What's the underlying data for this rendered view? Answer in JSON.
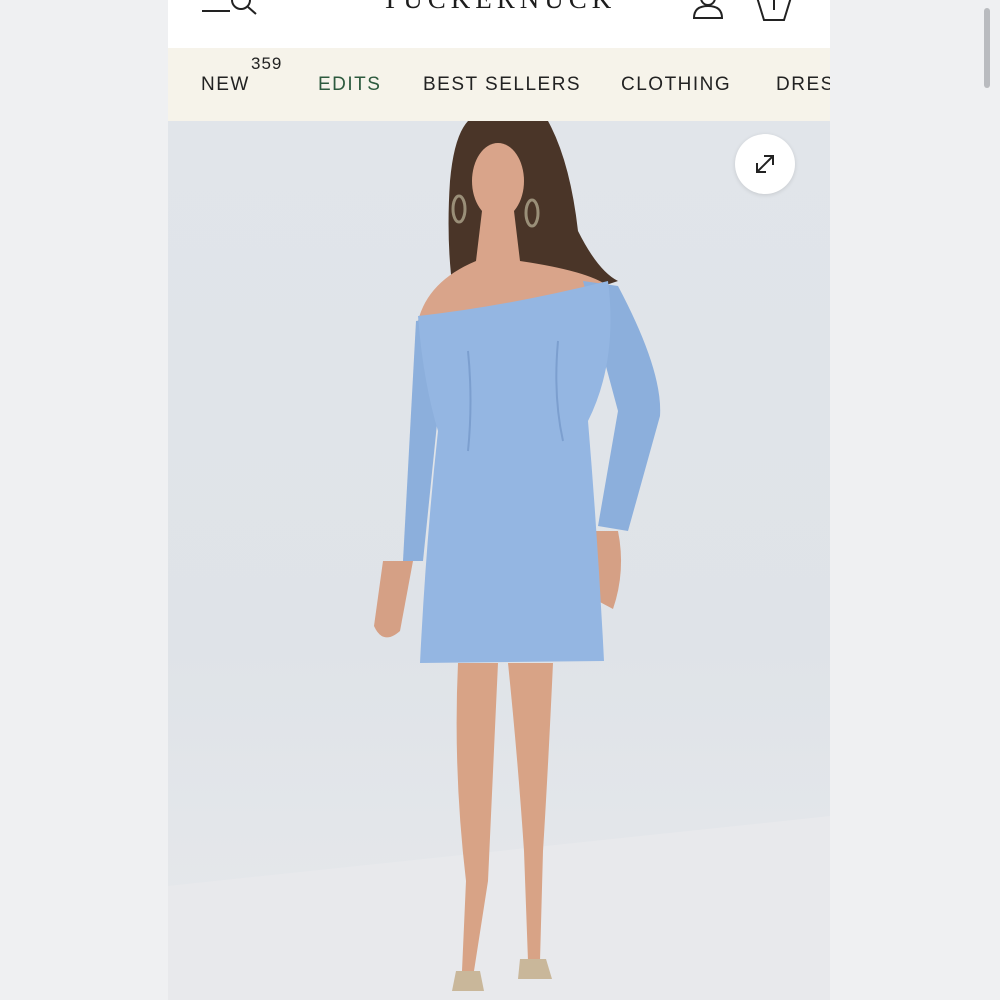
{
  "header": {
    "logo": "TUCKERNUCK",
    "icons": [
      "menu-search-icon",
      "account-icon",
      "shopping-bag-icon"
    ]
  },
  "nav": {
    "items": [
      {
        "label": "NEW",
        "badge": "359"
      },
      {
        "label": "EDITS"
      },
      {
        "label": "BEST SELLERS"
      },
      {
        "label": "CLOTHING"
      },
      {
        "label": "DRES"
      }
    ],
    "colors": {
      "background": "#f6f3ea",
      "edits": "#2d5a3e",
      "text": "#222222"
    }
  },
  "product_image": {
    "subject": "model wearing off-the-shoulder blue long-sleeve mini dress",
    "dress_color": "#94b6e2",
    "expand_icon": "expand-arrows-icon"
  }
}
